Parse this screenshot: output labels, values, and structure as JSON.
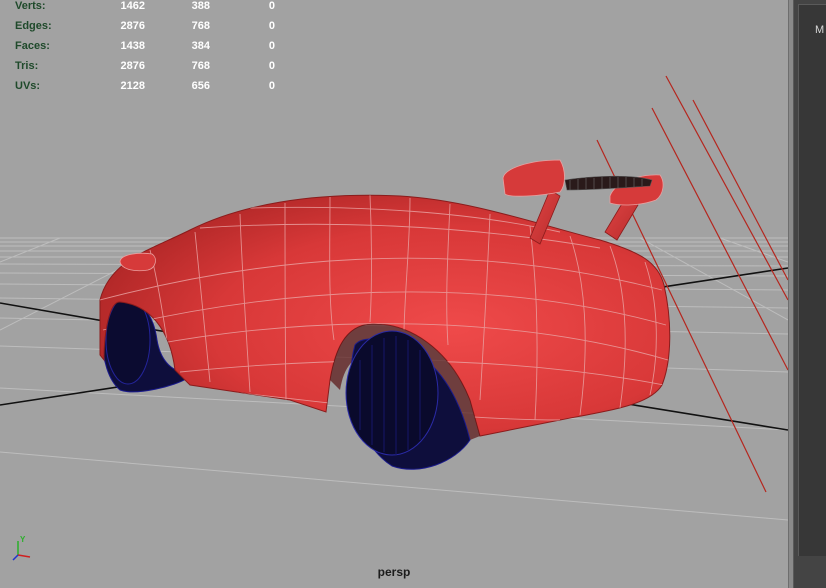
{
  "hud": {
    "rows": [
      {
        "label": "Verts:",
        "values": [
          "1462",
          "388",
          "0"
        ]
      },
      {
        "label": "Edges:",
        "values": [
          "2876",
          "768",
          "0"
        ]
      },
      {
        "label": "Faces:",
        "values": [
          "1438",
          "384",
          "0"
        ]
      },
      {
        "label": "Tris:",
        "values": [
          "2876",
          "768",
          "0"
        ]
      },
      {
        "label": "UVs:",
        "values": [
          "2128",
          "656",
          "0"
        ]
      }
    ]
  },
  "viewport": {
    "camera_label": "persp",
    "background_color": "#a2a2a2",
    "model_color": "#d63a3a",
    "tire_color": "#0d0d3a",
    "wire_color": "#1a1a8c"
  },
  "axis": {
    "y_label": "Y"
  },
  "side_panel": {
    "tab_label": "M"
  }
}
